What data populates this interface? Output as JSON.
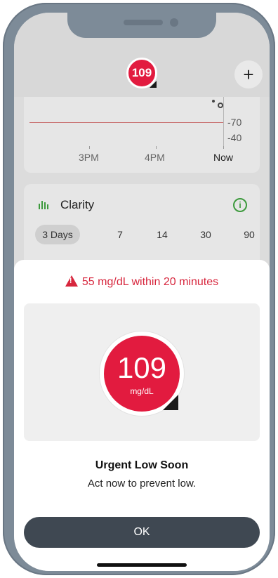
{
  "header": {
    "glucose_badge": "109",
    "add_label": "+"
  },
  "graph": {
    "y_labels": [
      "70",
      "40"
    ],
    "x_labels": [
      "3PM",
      "4PM",
      "Now"
    ]
  },
  "clarity": {
    "title": "Clarity",
    "info_label": "i",
    "ranges": [
      "3 Days",
      "7",
      "14",
      "30",
      "90"
    ],
    "selected_range": "3 Days"
  },
  "alert": {
    "warning": "55 mg/dL within 20 minutes",
    "value": "109",
    "unit": "mg/dL",
    "title": "Urgent Low Soon",
    "subtitle": "Act now to prevent low.",
    "ok_label": "OK"
  },
  "colors": {
    "urgent_red": "#e21b3f",
    "warning_red": "#d7263d",
    "clarity_green": "#3d9a3d",
    "button_dark": "#3f4852"
  },
  "icons": {
    "warning": "warning-triangle-icon",
    "clarity": "clarity-bars-icon",
    "info": "info-icon",
    "add": "plus-icon"
  }
}
